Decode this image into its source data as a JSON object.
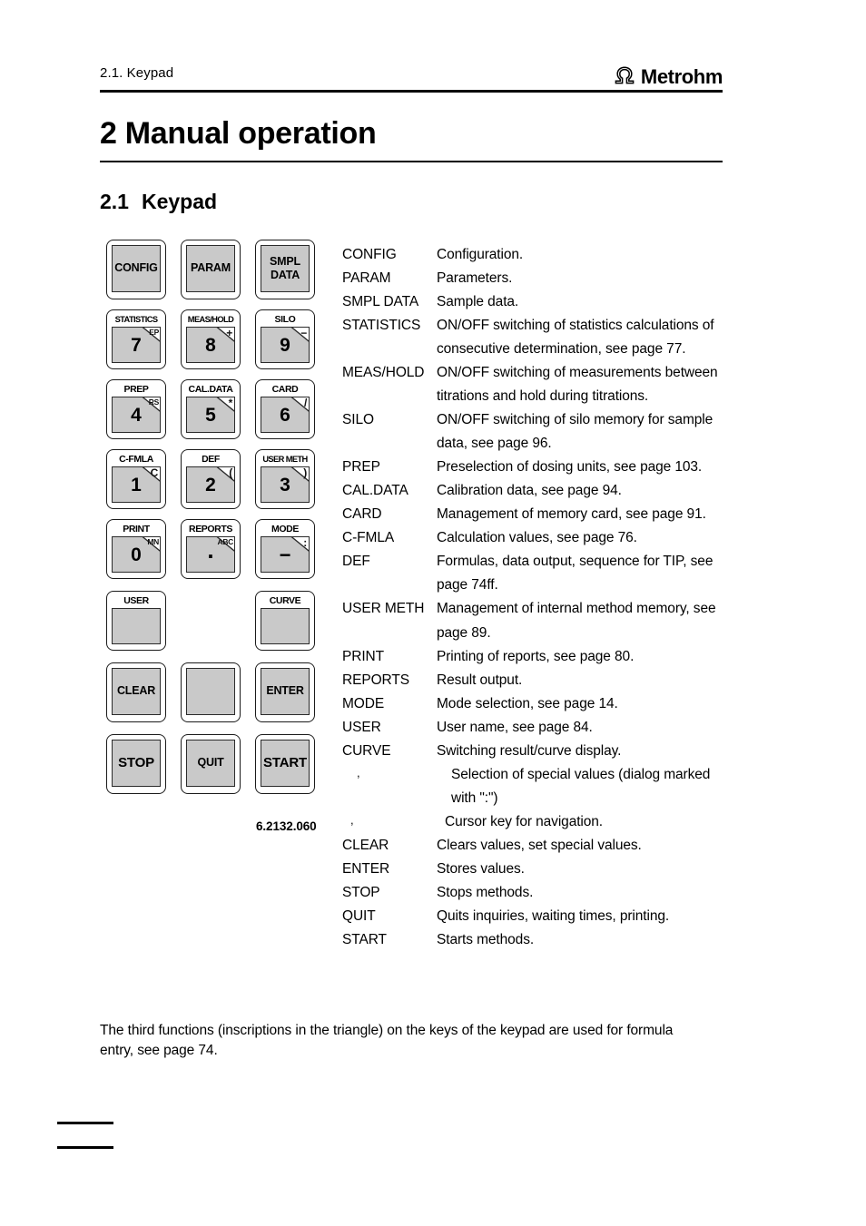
{
  "header": {
    "running_head": "2.1. Keypad",
    "logo_text": "Metrohm",
    "logo_mark": "omega-icon"
  },
  "chapter": {
    "title": "2 Manual operation"
  },
  "section": {
    "number": "2.1",
    "title": "Keypad"
  },
  "keypad": {
    "part_number": "6.2132.060",
    "rows": [
      [
        {
          "type": "command",
          "label": "CONFIG",
          "name": "key-config"
        },
        {
          "type": "command",
          "label": "PARAM",
          "name": "key-param"
        },
        {
          "type": "command",
          "label": "SMPL\nDATA",
          "label_line1": "SMPL",
          "label_line2": "DATA",
          "name": "key-smpl-data"
        }
      ],
      [
        {
          "type": "numeric",
          "tab": "STATISTICS",
          "digit": "7",
          "third": "EP",
          "name": "key-statistics-7"
        },
        {
          "type": "numeric",
          "tab": "MEAS/HOLD",
          "digit": "8",
          "third": "+",
          "name": "key-meas-hold-8"
        },
        {
          "type": "numeric",
          "tab": "SILO",
          "digit": "9",
          "third": "−",
          "name": "key-silo-9"
        }
      ],
      [
        {
          "type": "numeric",
          "tab": "PREP",
          "digit": "4",
          "third": "RS",
          "name": "key-prep-4"
        },
        {
          "type": "numeric",
          "tab": "CAL.DATA",
          "digit": "5",
          "third": "*",
          "name": "key-cal-data-5"
        },
        {
          "type": "numeric",
          "tab": "CARD",
          "digit": "6",
          "third": "/",
          "name": "key-card-6"
        }
      ],
      [
        {
          "type": "numeric",
          "tab": "C-FMLA",
          "digit": "1",
          "third": "C",
          "name": "key-c-fmla-1"
        },
        {
          "type": "numeric",
          "tab": "DEF",
          "digit": "2",
          "third": "(",
          "name": "key-def-2"
        },
        {
          "type": "numeric",
          "tab": "USER METH",
          "digit": "3",
          "third": ")",
          "name": "key-user-meth-3"
        }
      ],
      [
        {
          "type": "numeric",
          "tab": "PRINT",
          "digit": "0",
          "third": "MN",
          "name": "key-print-0"
        },
        {
          "type": "numeric",
          "tab": "REPORTS",
          "digit": ".",
          "third": "ABC",
          "name": "key-reports-dot"
        },
        {
          "type": "numeric",
          "tab": "MODE",
          "digit": "−",
          "third": ":",
          "name": "key-mode-minus"
        }
      ],
      [
        {
          "type": "tabonly",
          "tab": "USER",
          "name": "key-user"
        },
        {
          "type": "blank",
          "name": "key-blank-cursor-middle"
        },
        {
          "type": "tabonly",
          "tab": "CURVE",
          "name": "key-curve"
        }
      ],
      [
        {
          "type": "command",
          "label": "CLEAR",
          "name": "key-clear"
        },
        {
          "type": "blank-key",
          "name": "key-blank-cursor-lower"
        },
        {
          "type": "command",
          "label": "ENTER",
          "name": "key-enter"
        }
      ],
      [
        {
          "type": "command",
          "label": "STOP",
          "emphasis": "big",
          "name": "key-stop"
        },
        {
          "type": "command",
          "label": "QUIT",
          "name": "key-quit"
        },
        {
          "type": "command",
          "label": "START",
          "emphasis": "big",
          "name": "key-start"
        }
      ]
    ]
  },
  "descriptions": [
    {
      "term": "CONFIG",
      "definition": "Configuration."
    },
    {
      "term": "PARAM",
      "definition": "Parameters."
    },
    {
      "term": "SMPL DATA",
      "definition": "Sample data."
    },
    {
      "term": "STATISTICS",
      "definition": "ON/OFF switching of statistics calculations of consecutive determination, see page 77."
    },
    {
      "term": "MEAS/HOLD",
      "definition": "ON/OFF switching of measurements between titrations and hold during titrations."
    },
    {
      "term": "SILO",
      "definition": "ON/OFF switching of silo memory for sample data, see page 96."
    },
    {
      "term": "PREP",
      "definition": "Preselection of dosing units, see page 103."
    },
    {
      "term": "CAL.DATA",
      "definition": "Calibration data, see page 94."
    },
    {
      "term": "CARD",
      "definition": "Management of memory card, see page 91."
    },
    {
      "term": "C-FMLA",
      "definition": "Calculation values, see page 76."
    },
    {
      "term": "DEF",
      "definition": "Formulas, data output, sequence for TIP, see page 74ff."
    },
    {
      "term": "USER METH",
      "definition": "Management of internal method memory, see page 89."
    },
    {
      "term": "PRINT",
      "definition": "Printing of reports, see page 80."
    },
    {
      "term": "REPORTS",
      "definition": "Result output."
    },
    {
      "term": "MODE",
      "definition": "Mode selection, see page 14."
    },
    {
      "term": "USER",
      "definition": "User name, see page 84."
    },
    {
      "term": "CURVE",
      "definition": "Switching result/curve display."
    },
    {
      "term": ",",
      "definition": "Selection of special values (dialog marked with \":\")",
      "style": "arrow"
    },
    {
      "term": ",",
      "definition": "Cursor key for navigation.",
      "style": "arrow2"
    },
    {
      "term": "CLEAR",
      "definition": "Clears values, set special values."
    },
    {
      "term": "ENTER",
      "definition": "Stores values."
    },
    {
      "term": "STOP",
      "definition": "Stops methods."
    },
    {
      "term": "QUIT",
      "definition": "Quits inquiries, waiting times, printing."
    },
    {
      "term": "START",
      "definition": "Starts methods."
    }
  ],
  "note": "The third functions (inscriptions in the triangle) on the keys of the keypad are used for formula entry, see page 74."
}
